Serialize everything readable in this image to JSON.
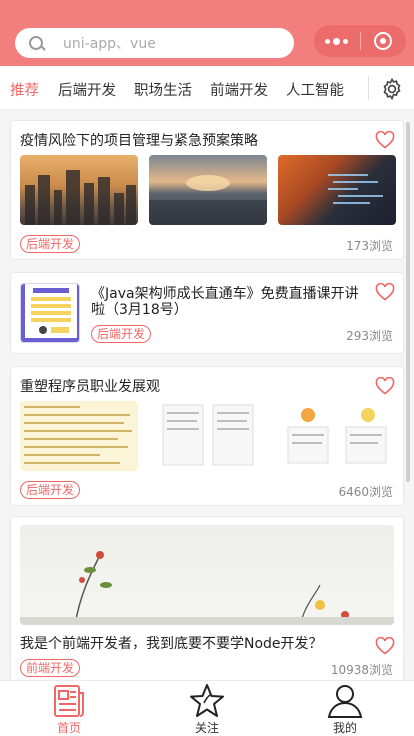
{
  "search": {
    "placeholder": "uni-app、vue"
  },
  "tabs": [
    {
      "label": "推荐",
      "active": true
    },
    {
      "label": "后端开发",
      "active": false
    },
    {
      "label": "职场生活",
      "active": false
    },
    {
      "label": "前端开发",
      "active": false
    },
    {
      "label": "人工智能",
      "active": false
    }
  ],
  "feed": {
    "items": [
      {
        "title": "疫情风险下的项目管理与紧急预案策略",
        "tag": "后端开发",
        "views": "173浏览"
      },
      {
        "title_line1": "《Java架构师成长直通车》免费直播课开讲",
        "title_line2": "啦（3月18号）",
        "tag": "后端开发",
        "views": "293浏览"
      },
      {
        "title": "重塑程序员职业发展观",
        "tag": "后端开发",
        "views": "6460浏览"
      },
      {
        "title": "我是个前端开发者，我到底要不要学Node开发？",
        "tag": "前端开发",
        "views": "10938浏览"
      }
    ]
  },
  "tabbar": [
    {
      "label": "首页",
      "icon": "news-icon",
      "active": true
    },
    {
      "label": "关注",
      "icon": "star-icon",
      "active": false
    },
    {
      "label": "我的",
      "icon": "user-icon",
      "active": false
    }
  ],
  "colors": {
    "accent": "#f06767",
    "header": "#f27e7e"
  }
}
